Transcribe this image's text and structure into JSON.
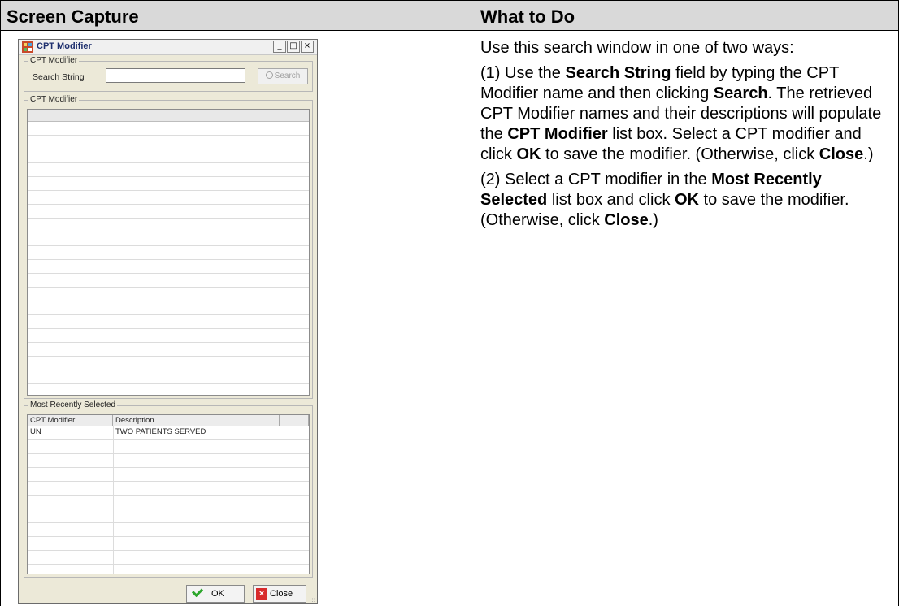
{
  "table": {
    "header_left": "Screen Capture",
    "header_right": "What to Do"
  },
  "dialog": {
    "title": "CPT Modifier",
    "min_symbol": "_",
    "max_symbol": "□",
    "close_symbol": "×",
    "search_group_label": "CPT Modifier",
    "search_label": "Search String",
    "search_value": "",
    "search_button": "Search",
    "list_group_label": "CPT Modifier",
    "recent_group_label": "Most Recently Selected",
    "recent_columns": [
      "CPT Modifier",
      "Description",
      ""
    ],
    "recent_rows": [
      {
        "modifier": "UN",
        "description": "TWO PATIENTS SERVED"
      }
    ],
    "ok_button": "OK",
    "close_button": "Close",
    "resize_grip": ".::"
  },
  "instructions": {
    "p1": "Use this search window in one of two ways:",
    "p2_a": "(1) Use the ",
    "p2_b": "Search String",
    "p2_c": " field by typing the CPT Modifier name and then clicking ",
    "p2_d": "Search",
    "p2_e": ". The retrieved CPT Modifier names and their descriptions will populate the ",
    "p2_f": "CPT Modifier",
    "p2_g": " list box. Select a CPT modifier and click ",
    "p2_h": "OK",
    "p2_i": " to save the modifier. (Otherwise, click ",
    "p2_j": "Close",
    "p2_k": ".)",
    "p3_a": "(2) Select a CPT modifier in the ",
    "p3_b": "Most Recently Selected",
    "p3_c": " list box and click ",
    "p3_d": "OK",
    "p3_e": " to save the modifier. (Otherwise, click ",
    "p3_f": "Close",
    "p3_g": ".)"
  },
  "colors": {
    "header_bg": "#d9d9d9",
    "dialog_bg": "#ece9d8",
    "title_text": "#1e2f6e"
  }
}
